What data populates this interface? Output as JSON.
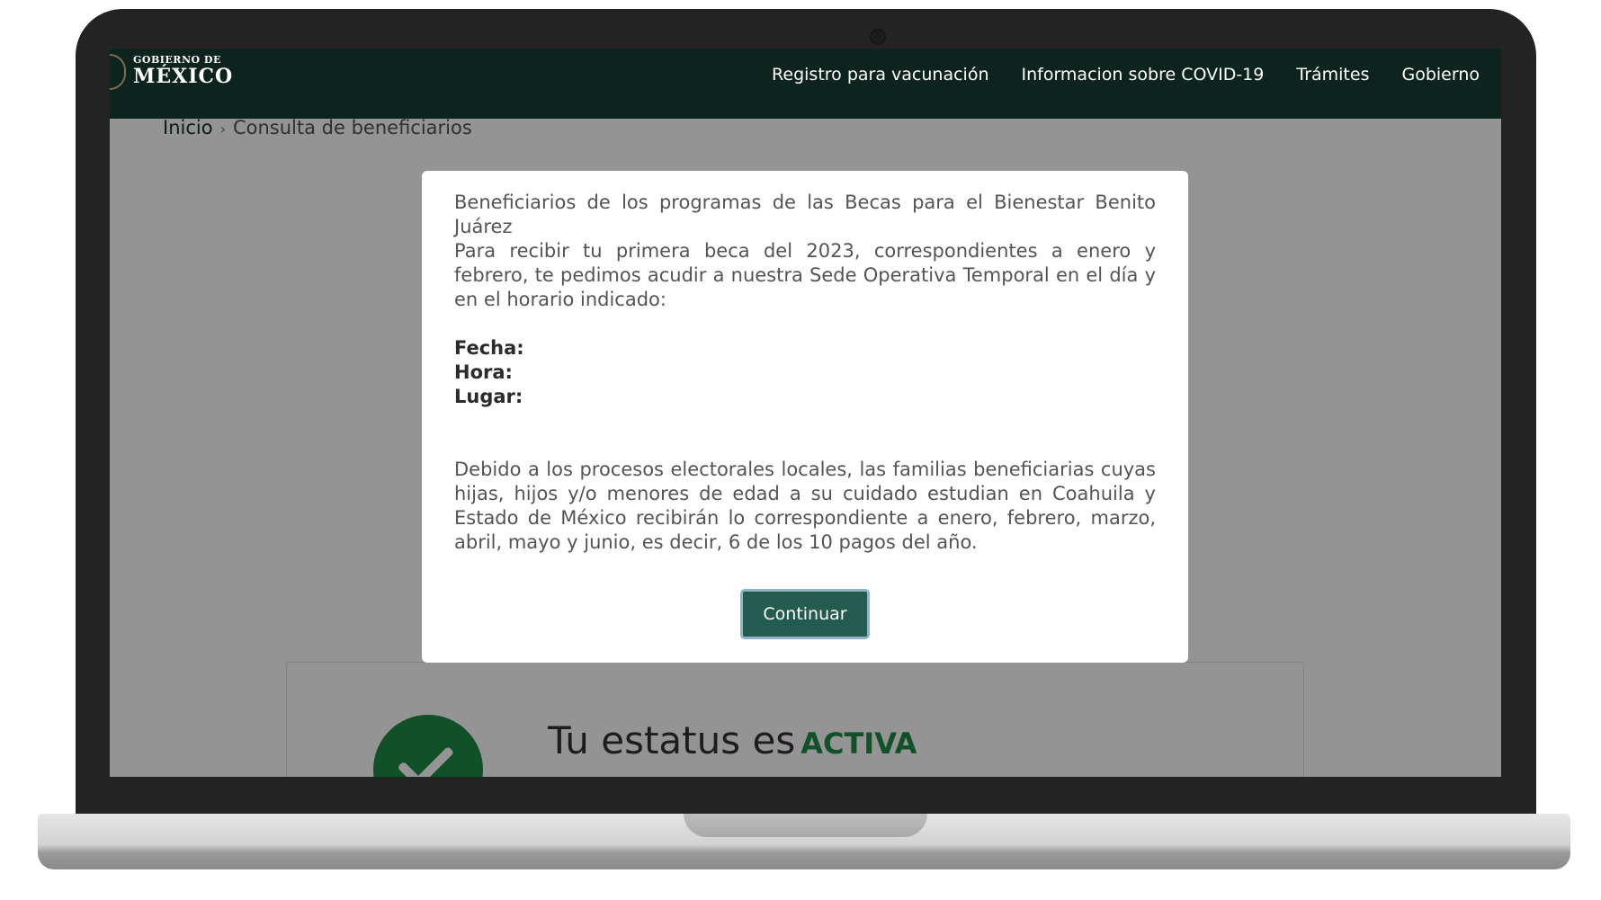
{
  "header": {
    "logo_small": "GOBIERNO DE",
    "logo_big": "MÉXICO",
    "nav": [
      "Registro para vacunación",
      "Informacion sobre COVID-19",
      "Trámites",
      "Gobierno"
    ]
  },
  "breadcrumb": {
    "home": "Inicio",
    "separator": "›",
    "current": "Consulta de beneficiarios"
  },
  "modal": {
    "title": "Beneficiarios de los programas de las Becas para el Bienestar Benito Juárez",
    "intro": "Para recibir tu primera beca del 2023, correspondientes a enero y febrero, te pedimos acudir a nuestra Sede Operativa Temporal en el día y en el horario indicado:",
    "fields": [
      {
        "label": "Fecha:",
        "value": ""
      },
      {
        "label": "Hora:",
        "value": ""
      },
      {
        "label": "Lugar:",
        "value": ""
      }
    ],
    "notice": "Debido a los procesos electorales locales, las familias beneficiarias cuyas hijas, hijos y/o menores de edad a su cuidado estudian en Coahuila y Estado de México recibirán lo correspondiente a enero, febrero, marzo, abril, mayo y junio, es decir, 6 de los 10 pagos del año.",
    "button_label": "Continuar"
  },
  "status": {
    "prefix": "Tu estatus es",
    "value": "ACTIVA",
    "color": "#1e8c45"
  },
  "colors": {
    "header_bg": "#0c231e",
    "button_bg": "#235b4e"
  }
}
